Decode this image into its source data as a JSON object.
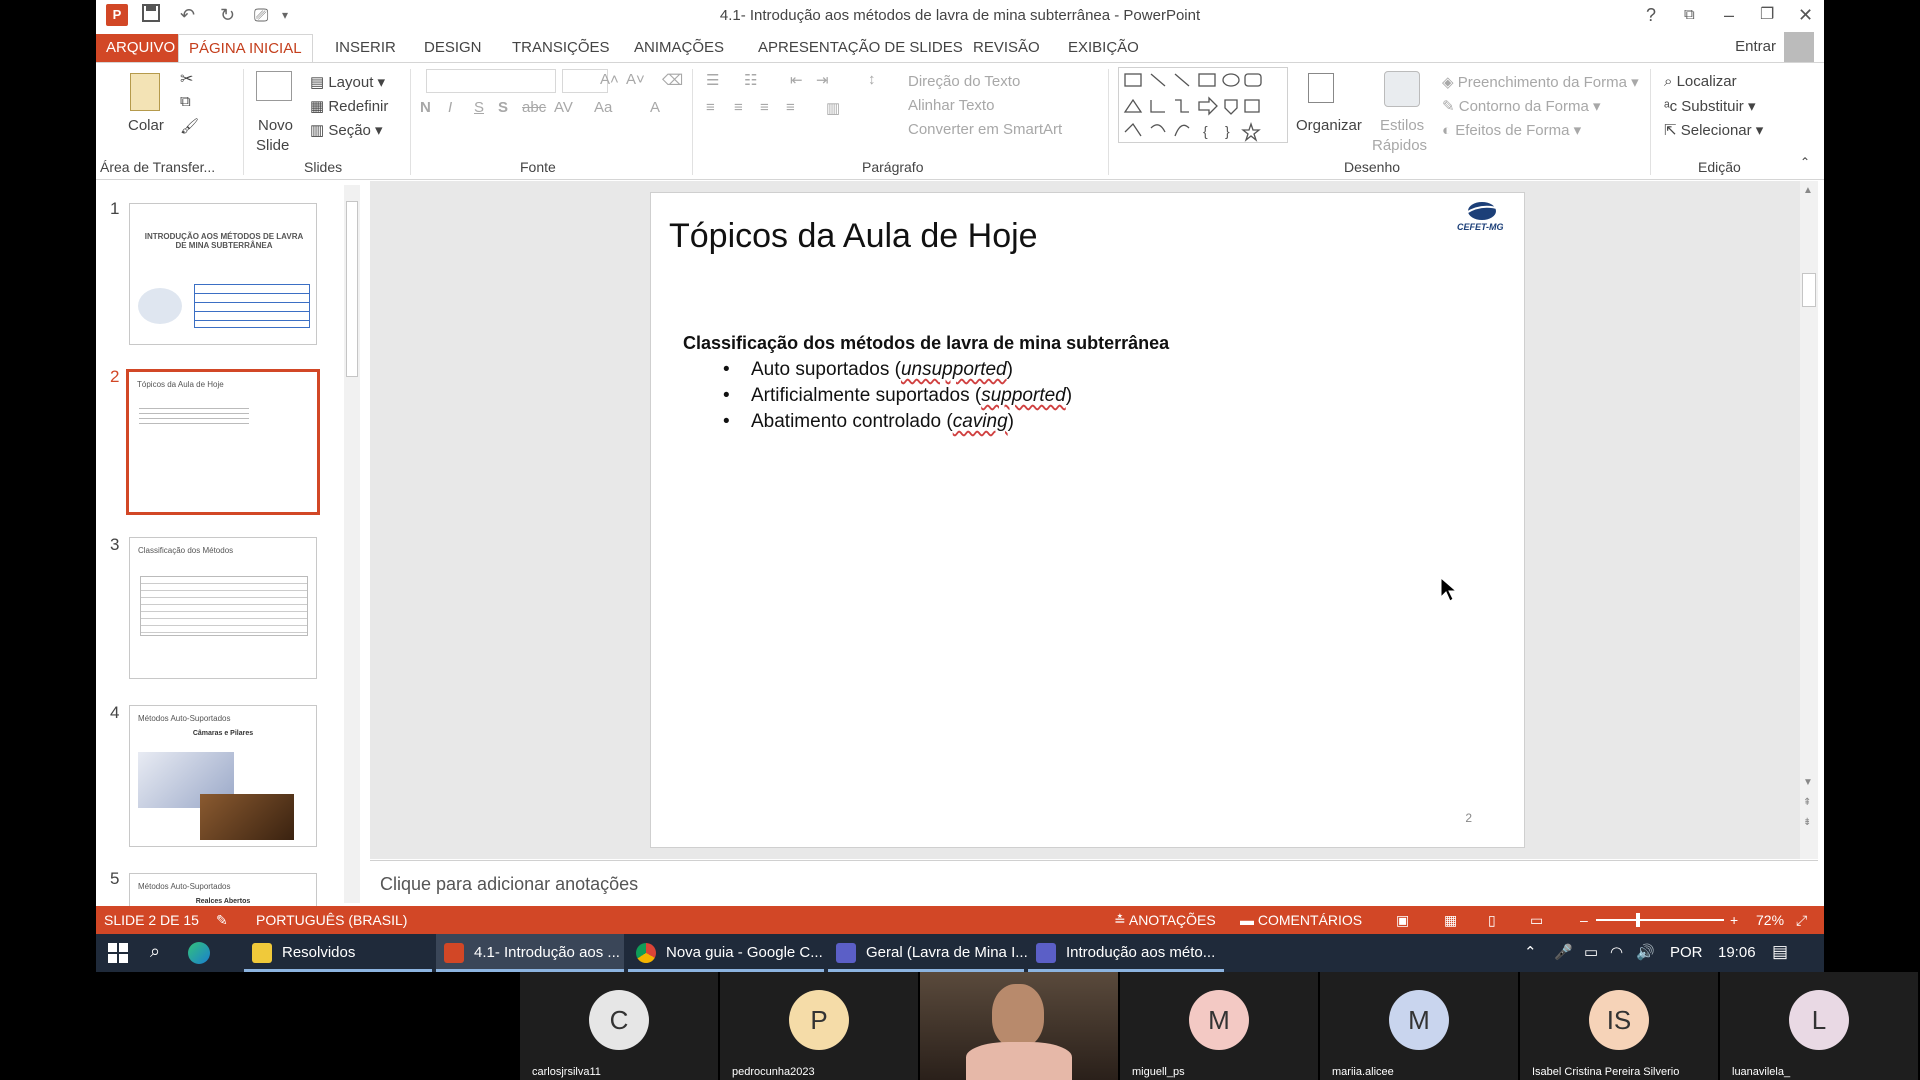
{
  "window": {
    "title": "4.1- Introdução aos métodos de lavra de mina subterrânea - PowerPoint",
    "help": "?",
    "app_logo": "P"
  },
  "tabs": [
    "ARQUIVO",
    "PÁGINA INICIAL",
    "INSERIR",
    "DESIGN",
    "TRANSIÇÕES",
    "ANIMAÇÕES",
    "APRESENTAÇÃO DE SLIDES",
    "REVISÃO",
    "EXIBIÇÃO"
  ],
  "account": {
    "signin": "Entrar"
  },
  "ribbon": {
    "clipboard": {
      "paste": "Colar",
      "label": "Área de Transfer..."
    },
    "slides": {
      "new_slide_1": "Novo",
      "new_slide_2": "Slide",
      "layout": "Layout",
      "reset": "Redefinir",
      "section": "Seção",
      "label": "Slides"
    },
    "font": {
      "bold": "N",
      "italic": "I",
      "underline": "S",
      "shadow": "S",
      "strike": "abc",
      "spacing": "AV",
      "case": "Aa",
      "color": "A",
      "label": "Fonte"
    },
    "paragraph": {
      "text_direction": "Direção do Texto",
      "align_text": "Alinhar Texto",
      "smartart": "Converter em SmartArt",
      "label": "Parágrafo"
    },
    "drawing": {
      "arrange": "Organizar",
      "quick_styles_1": "Estilos",
      "quick_styles_2": "Rápidos",
      "fill": "Preenchimento da Forma",
      "outline": "Contorno da Forma",
      "effects": "Efeitos de Forma",
      "label": "Desenho"
    },
    "editing": {
      "find": "Localizar",
      "replace": "Substituir",
      "select": "Selecionar",
      "label": "Edição"
    }
  },
  "thumbnails": [
    {
      "num": "1",
      "title": "INTRODUÇÃO AOS MÉTODOS DE LAVRA DE MINA SUBTERRÂNEA"
    },
    {
      "num": "2",
      "title": "Tópicos da Aula de Hoje"
    },
    {
      "num": "3",
      "title": "Classificação dos Métodos"
    },
    {
      "num": "4",
      "title": "Métodos Auto-Suportados",
      "subtitle": "Câmaras e Pilares"
    },
    {
      "num": "5",
      "title": "Métodos Auto-Suportados",
      "subtitle": "Realces Abertos"
    }
  ],
  "slide": {
    "title": "Tópicos da Aula de Hoje",
    "heading": "Classificação dos métodos de lavra de mina subterrânea",
    "bullets": [
      {
        "text": "Auto suportados (",
        "em": "unsupported",
        "end": ")"
      },
      {
        "text": "Artificialmente suportados (",
        "em": "supported",
        "end": ")"
      },
      {
        "text": "Abatimento controlado (",
        "em": "caving",
        "end": ")"
      }
    ],
    "number": "2",
    "logo_text": "CEFET-MG"
  },
  "notes": {
    "placeholder": "Clique para adicionar anotações"
  },
  "status": {
    "slide_info": "SLIDE 2 DE 15",
    "language": "PORTUGUÊS (BRASIL)",
    "notes": "ANOTAÇÕES",
    "comments": "COMENTÁRIOS",
    "zoom": "72%"
  },
  "taskbar": {
    "items": [
      "Resolvidos",
      "4.1- Introdução aos ...",
      "Nova guia - Google C...",
      "Geral (Lavra de Mina I...",
      "Introdução aos méto..."
    ],
    "lang": "POR",
    "time": "19:06"
  },
  "participants": [
    {
      "initials": "C",
      "name": "carlosjrsilva11",
      "color": "#e6e6e6"
    },
    {
      "initials": "P",
      "name": "pedrocunha2023",
      "color": "#f5dca8"
    },
    {
      "initials": "",
      "name": "",
      "color": "#6a5a4a"
    },
    {
      "initials": "M",
      "name": "miguell_ps",
      "color": "#f3c9c4"
    },
    {
      "initials": "M",
      "name": "mariia.alicee",
      "color": "#c9d5ee"
    },
    {
      "initials": "IS",
      "name": "Isabel Cristina Pereira Silverio",
      "color": "#f6d3b8"
    },
    {
      "initials": "L",
      "name": "luanavilela_",
      "color": "#e9d9e4"
    }
  ]
}
